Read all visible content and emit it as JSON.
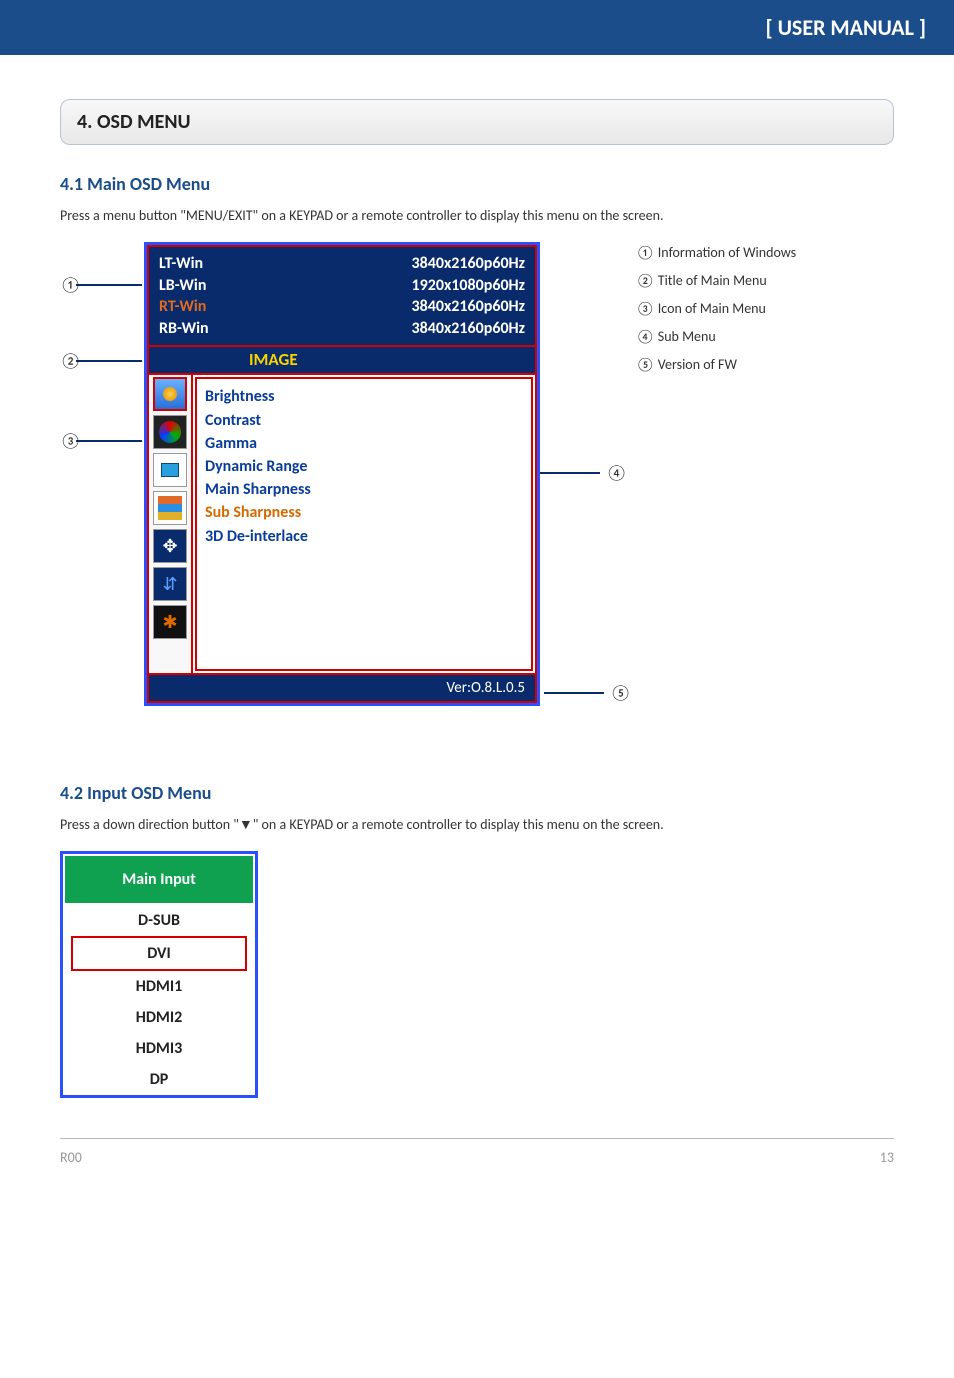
{
  "header": {
    "title": "[ USER MANUAL ]"
  },
  "section": {
    "title": "4. OSD MENU"
  },
  "s41": {
    "heading": "4.1 Main OSD Menu",
    "text": "Press a menu button \"MENU/EXIT\" on a KEYPAD or a remote controller to display this menu on the screen."
  },
  "osd": {
    "info": {
      "rows": [
        {
          "label": "LT-Win",
          "value": "3840x2160p60Hz",
          "cls": ""
        },
        {
          "label": "LB-Win",
          "value": "1920x1080p60Hz",
          "cls": ""
        },
        {
          "label": "RT-Win",
          "value": "3840x2160p60Hz",
          "cls": "rt"
        },
        {
          "label": "RB-Win",
          "value": "3840x2160p60Hz",
          "cls": ""
        }
      ]
    },
    "title": "IMAGE",
    "submenu": [
      {
        "label": "Brightness",
        "cls": ""
      },
      {
        "label": "Contrast",
        "cls": ""
      },
      {
        "label": "Gamma",
        "cls": ""
      },
      {
        "label": "Dynamic Range",
        "cls": ""
      },
      {
        "label": "Main Sharpness",
        "cls": ""
      },
      {
        "label": "Sub Sharpness",
        "cls": "orange"
      },
      {
        "label": "3D De-interlace",
        "cls": ""
      }
    ],
    "footer": "Ver:O.8.L.0.5",
    "icons": [
      "image-icon",
      "color-icon",
      "window-icon",
      "grid-icon",
      "move-icon",
      "tune-icon",
      "burn-icon"
    ]
  },
  "legend": {
    "c1": "①",
    "t1": "Information of Windows",
    "c2": "②",
    "t2": "Title of Main Menu",
    "c3": "③",
    "t3": "Icon of Main Menu",
    "c4": "④",
    "t4": "Sub Menu",
    "c5": "⑤",
    "t5": "Version of FW"
  },
  "s42": {
    "heading": "4.2 Input OSD Menu",
    "text": "Press a down direction button \"▼\" on a KEYPAD or a remote controller to display this menu on the screen."
  },
  "input": {
    "title": "Main Input",
    "items": [
      "D-SUB",
      "DVI",
      "HDMI1",
      "HDMI2",
      "HDMI3",
      "DP"
    ],
    "selected": "DVI"
  },
  "footer": {
    "rev": "R00",
    "page": "13"
  }
}
